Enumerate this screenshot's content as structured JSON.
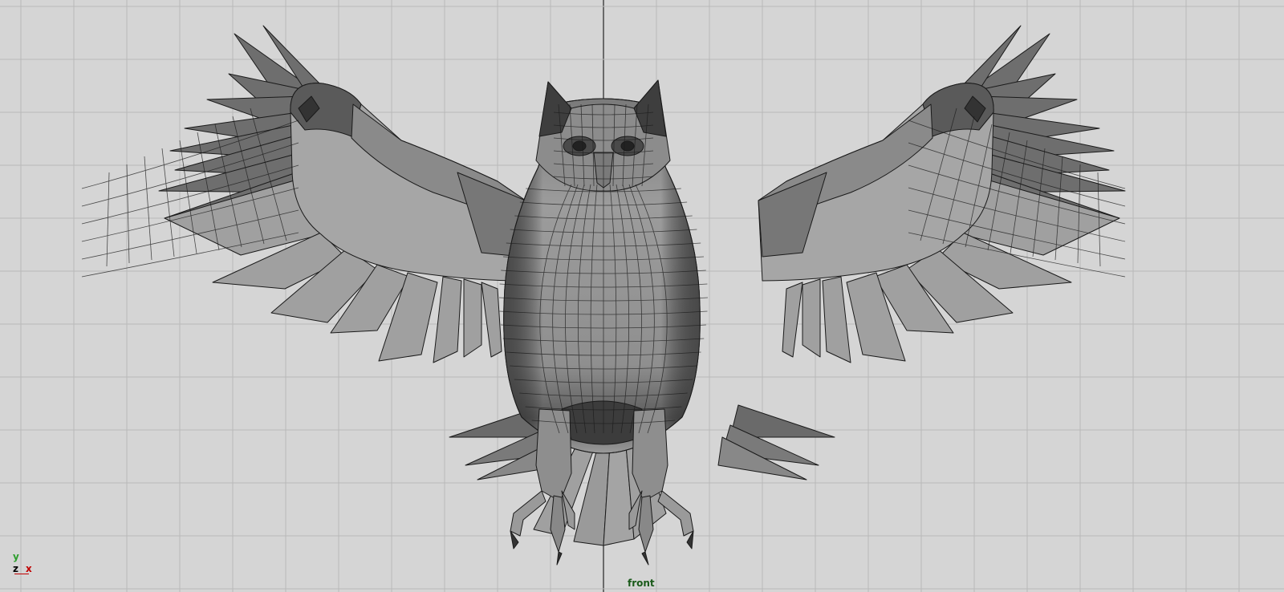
{
  "viewport": {
    "camera_name": "front",
    "background": "#d5d5d5",
    "grid_color": "#b9b9b9",
    "center_axis_color": "#000000",
    "model": {
      "name": "owl-polygon-mesh",
      "fill_light": "#a4a4a4",
      "fill_mid": "#8a8a8a",
      "fill_dark": "#555555",
      "wire_color": "#1a1a1a"
    }
  },
  "axis_indicator": {
    "y_label": "y",
    "z_label": "z",
    "x_label": "x",
    "y_color": "#2e9e2e",
    "z_color": "#000000",
    "x_color": "#c00000"
  }
}
